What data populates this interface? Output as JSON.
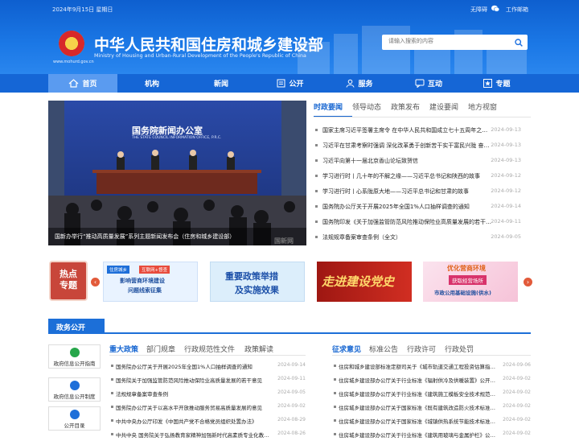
{
  "topbar": {
    "date": "2024年9月15日 星期日",
    "accessibility": "无障碍",
    "wechat_icon": "wechat-icon",
    "work_mail": "工作邮箱"
  },
  "header": {
    "title": "中华人民共和国住房和城乡建设部",
    "subtitle": "Ministry of Housing and Urban-Rural Development of the People's Republic of China",
    "url": "www.mohurd.gov.cn"
  },
  "search": {
    "placeholder": "请输入搜索的内容"
  },
  "nav": [
    {
      "label": "首页",
      "icon": "home-icon"
    },
    {
      "label": "机构",
      "icon": ""
    },
    {
      "label": "新闻",
      "icon": ""
    },
    {
      "label": "公开",
      "icon": "document-icon"
    },
    {
      "label": "服务",
      "icon": "person-icon"
    },
    {
      "label": "互动",
      "icon": "chat-icon"
    },
    {
      "label": "专题",
      "icon": "star-icon"
    }
  ],
  "banner": {
    "caption": "国新办举行“推动高质量发展”系列主题新闻发布会（住房和城乡建设部）",
    "backdrop_cn": "国务院新闻办公室",
    "backdrop_en": "THE STATE COUNCIL INFORMATION OFFICE, P.R.C.",
    "watermark": "国新网"
  },
  "news": {
    "tabs": [
      "时政要闻",
      "领导动态",
      "政策发布",
      "建设要闻",
      "地方视窗"
    ],
    "items": [
      {
        "title": "国家主席习近平签署主席令 在中华人民共和国成立七十五周年之际授予国家勋章和国家荣誉称号",
        "date": "2024-09-13"
      },
      {
        "title": "习近平在甘肃考察时强调 深化改革勇于创新苦干实干富民兴陇 奋力谱写中国式现代化甘肃篇章",
        "date": "2024-09-13"
      },
      {
        "title": "习近平向第十一届北京香山论坛致贺信",
        "date": "2024-09-13"
      },
      {
        "title": "学习进行时丨几十年的不解之缘——习近平总书记和陕西的故事",
        "date": "2024-09-12"
      },
      {
        "title": "学习进行时丨心系陇原大地——习近平总书记和甘肃的故事",
        "date": "2024-09-12"
      },
      {
        "title": "国务院办公厅关于开展2025年全国1%人口抽样调查的通知",
        "date": "2024-09-14"
      },
      {
        "title": "国务院印发《关于加强监管防范风险推动保险业高质量发展的若干意见》",
        "date": "2024-09-11"
      },
      {
        "title": "法规规章备案审查条例（全文）",
        "date": "2024-09-05"
      }
    ]
  },
  "promos": {
    "hot": "热点专题",
    "p1_tag1": "住房城乡",
    "p1_tag2": "互联网+督查",
    "p1_line1": "影响营商环境建设",
    "p1_line2": "问题线索征集",
    "p2_line1": "重要政策举措",
    "p2_line2": "及实施效果",
    "p3_text": "走进建设党史",
    "p4_line1": "优化营商环境",
    "p4_line2": "获取经营场所",
    "p4_line3": "市政公用基础设施(供水)"
  },
  "gov": {
    "tag": "政务公开",
    "side": [
      {
        "label": "政府信息公开指南",
        "icon": "guide-icon",
        "color": "#27a64a"
      },
      {
        "label": "政府信息公开制度",
        "icon": "rules-icon",
        "color": "#1e6fd9"
      },
      {
        "label": "公开目录",
        "icon": "catalog-icon",
        "color": "#1e6fd9"
      }
    ],
    "left_tabs": [
      "重大政策",
      "部门规章",
      "行政规范性文件",
      "政策解读"
    ],
    "left_items": [
      {
        "title": "国务院办公厅关于开展2025年全国1%人口抽样调查的通知",
        "date": "2024-09-14"
      },
      {
        "title": "国务院关于加强监管防范风险推动保险业高质量发展的若干意见",
        "date": "2024-09-11"
      },
      {
        "title": "法规规章备案审查条例",
        "date": "2024-09-05"
      },
      {
        "title": "国务院办公厅关于以高水平开放推动服务贸易高质量发展的意见",
        "date": "2024-09-02"
      },
      {
        "title": "中共中央办公厅印发《中国共产党不合格党员组织处置办法》",
        "date": "2024-08-29"
      },
      {
        "title": "中共中央 国务院关于弘扬教育家精神加强新时代高素质专业化教师队伍建设的意见",
        "date": "2024-08-26"
      }
    ],
    "right_tabs": [
      "征求意见",
      "标准公告",
      "行政许可",
      "行政处罚"
    ],
    "right_items": [
      {
        "title": "住房和城乡建设部标准定额司关于《城市轨道交通工程投资估算指标》公开征求意见的通知",
        "date": "2024-09-06"
      },
      {
        "title": "住房城乡建设部办公厅关于行业标准《辐射供冷及供暖装置》公开征求意见的通知",
        "date": "2024-09-02"
      },
      {
        "title": "住房城乡建设部办公厅关于行业标准《建筑施工模板安全技术规范》公开征求意见的通知",
        "date": "2024-09-02"
      },
      {
        "title": "住房城乡建设部办公厅关于国家标准《既有建筑改造防火技术标准》公开征求意见的通知",
        "date": "2024-09-02"
      },
      {
        "title": "住房城乡建设部办公厅关于国家标准《城镇供热系统节能技术标准》公开征求意见的通知",
        "date": "2024-09-02"
      },
      {
        "title": "住房城乡建设部办公厅关于行业标准《建筑用玻璃与金属护栏》公开征求意见的通知",
        "date": "2024-09-02"
      }
    ]
  },
  "colors": {
    "primary": "#1566d6",
    "nav_active": "#5a9bf0",
    "accent_red": "#e25a3a"
  }
}
